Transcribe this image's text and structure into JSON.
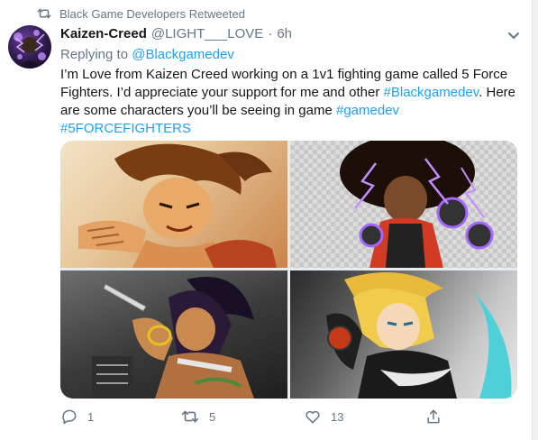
{
  "retweet_banner": {
    "text": "Black Game Developers Retweeted"
  },
  "tweet": {
    "author_name": "Kaizen-Creed",
    "author_handle": "@LIGHT___LOVE",
    "separator": "·",
    "time": "6h",
    "reply_prefix": "Replying to",
    "reply_to": "@Blackgamedev",
    "text_part1": "I’m Love from Kaizen Creed working on a 1v1 fighting game called 5 Force Fighters. I’d appreciate your support for me and other ",
    "hashtag1": "#Blackgamedev",
    "text_part2": ". Here are some characters you’ll be seeing in game ",
    "hashtag2": "#gamedev",
    "hashtag3": "#5FORCEFIGHTERS"
  },
  "actions": {
    "reply_count": "1",
    "retweet_count": "5",
    "like_count": "13"
  },
  "icons": {
    "retweet_banner": "retweet-icon",
    "caret": "chevron-down-icon",
    "reply": "comment-icon",
    "retweet": "retweet-icon",
    "like": "heart-icon",
    "share": "share-icon"
  },
  "colors": {
    "link": "#1da1f2",
    "muted": "#657786",
    "text": "#14171a"
  }
}
